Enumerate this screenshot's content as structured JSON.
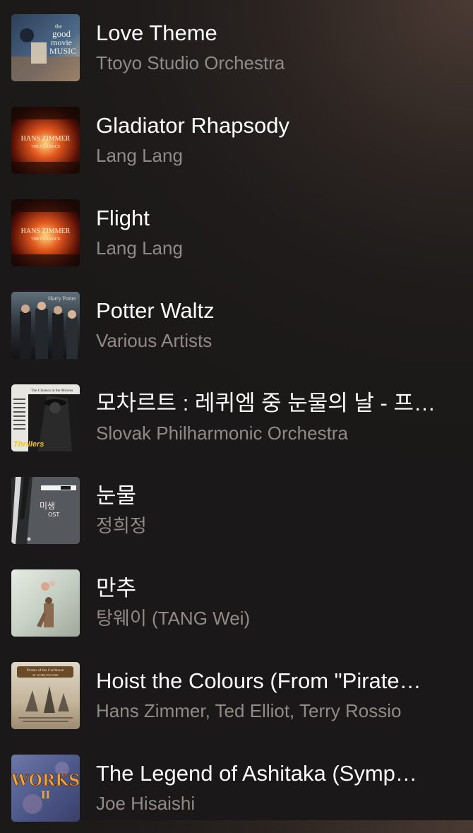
{
  "songs": [
    {
      "title": "Love Theme",
      "artist": "Ttoyo Studio Orchestra",
      "artwork": "album-art-good-movie-music",
      "artwork_text": [
        "the",
        "good",
        "movie",
        "MUSIC"
      ]
    },
    {
      "title": "Gladiator Rhapsody",
      "artist": "Lang Lang",
      "artwork": "album-art-hans-zimmer-classics",
      "artwork_text": [
        "HANS ZIMMER",
        "THE CLASSICS"
      ]
    },
    {
      "title": "Flight",
      "artist": "Lang Lang",
      "artwork": "album-art-hans-zimmer-classics",
      "artwork_text": [
        "HANS ZIMMER",
        "THE CLASSICS"
      ]
    },
    {
      "title": "Potter Waltz",
      "artist": "Various Artists",
      "artwork": "album-art-harry-potter",
      "artwork_text": [
        "Harry Potter"
      ]
    },
    {
      "title": "모차르트 : 레퀴엠 중 눈물의 날 - 프…",
      "artist": "Slovak Philharmonic Orchestra",
      "artwork": "album-art-classics-at-the-movies-thrillers",
      "artwork_text": [
        "The Classics at the Movies",
        "Thrillers"
      ]
    },
    {
      "title": "눈물",
      "artist": "정희정",
      "artwork": "album-art-misaeng-ost",
      "artwork_text": [
        "미생",
        "OST"
      ]
    },
    {
      "title": "만추",
      "artist": "탕웨이 (TANG Wei)",
      "artwork": "album-art-late-autumn",
      "artwork_text": []
    },
    {
      "title": "Hoist the Colours (From \"Pirate…",
      "artist": "Hans Zimmer, Ted Elliot, Terry Rossio",
      "artwork": "album-art-pirates-of-the-caribbean",
      "artwork_text": [
        "Pirates of the Caribbean",
        "AT WORLD'S END"
      ]
    },
    {
      "title": "The Legend of Ashitaka (Symp…",
      "artist": "Joe Hisaishi",
      "artwork": "album-art-works-joe-hisaishi",
      "artwork_text": [
        "WORKS",
        "II"
      ]
    }
  ]
}
